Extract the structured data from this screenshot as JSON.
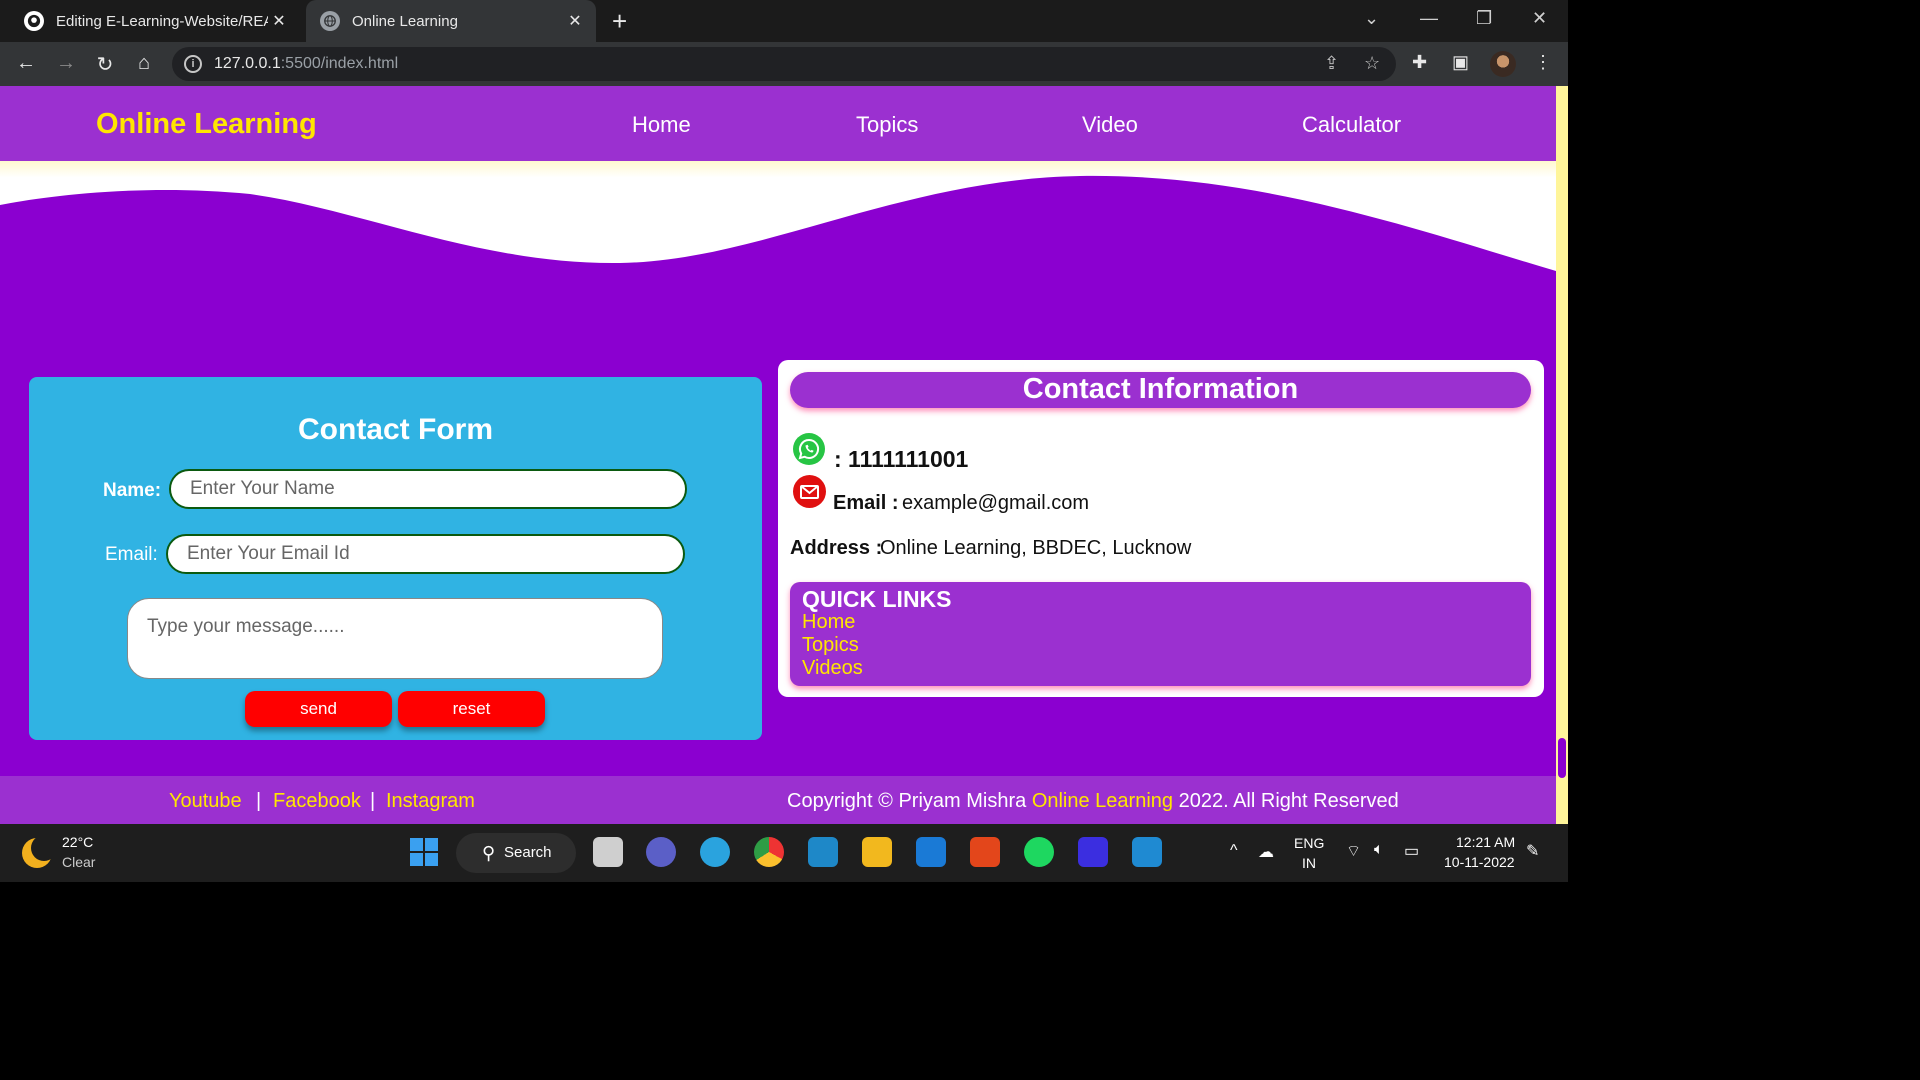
{
  "browser": {
    "tabs": [
      {
        "title": "Editing E-Learning-Website/README",
        "icon": "github-icon",
        "active": false
      },
      {
        "title": "Online Learning",
        "icon": "globe-icon",
        "active": true
      }
    ],
    "url_host": "127.0.0.1",
    "url_path": ":5500/index.html"
  },
  "site": {
    "logo": "Online Learning",
    "nav": [
      "Home",
      "Topics",
      "Video",
      "Calculator"
    ],
    "colors": {
      "header": "#9b30d0",
      "body": "#8b00d0",
      "accent": "#ffe600",
      "form": "#30b3e3",
      "button": "#ff0000"
    }
  },
  "contact_form": {
    "title": "Contact Form",
    "name_label": "Name:",
    "name_placeholder": "Enter Your Name",
    "email_label": "Email:",
    "email_placeholder": "Enter Your Email Id",
    "message_placeholder": "Type your message......",
    "send_label": "send",
    "reset_label": "reset"
  },
  "contact_info": {
    "title": "Contact Information",
    "phone": ": 1111111001",
    "email_label": "Email :",
    "email_value": "example@gmail.com",
    "address_label": "Address :",
    "address_value": "Online Learning, BBDEC, Lucknow",
    "quick_links_title": "QUICK LINKS",
    "quick_links": [
      "Home",
      "Topics",
      "Videos"
    ]
  },
  "footer": {
    "social": [
      "Youtube",
      "Facebook",
      "Instagram"
    ],
    "separator": "|",
    "copyright_prefix": "Copyright © Priyam Mishra",
    "copyright_brand": "Online Learning",
    "copyright_suffix": "2022. All Right Reserved"
  },
  "taskbar": {
    "temperature": "22°C",
    "weather": "Clear",
    "search": "Search",
    "lang_top": "ENG",
    "lang_bottom": "IN",
    "time": "12:21 AM",
    "date": "10-11-2022"
  }
}
